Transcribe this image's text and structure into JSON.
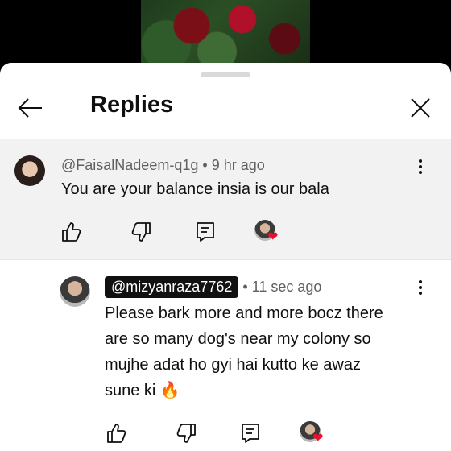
{
  "header": {
    "title": "Replies"
  },
  "parent": {
    "handle": "@FaisalNadeem-q1g",
    "separator": "•",
    "time": "9 hr ago",
    "text": "You are your balance insia is our bala"
  },
  "reply": {
    "handle": "@mizyanraza7762",
    "separator": "•",
    "time": "11 sec ago",
    "text_lines": [
      "Please bark more and more bocz there",
      "are so many dog's near my colony so",
      "mujhe adat ho gyi hai kutto ke awaz",
      "sune ki 🔥"
    ]
  },
  "icons": {
    "heart": "❤"
  },
  "colors": {
    "handle_badge_bg": "#111111",
    "heart": "#e8102c",
    "parent_bg": "#f2f2f2"
  }
}
